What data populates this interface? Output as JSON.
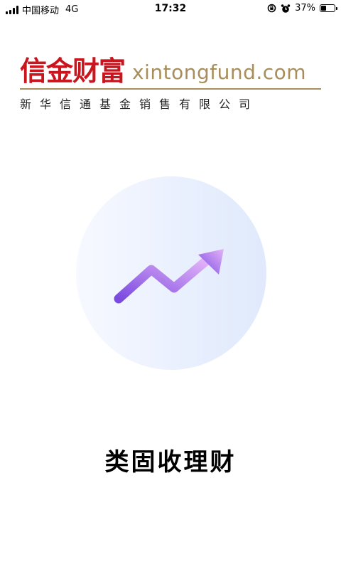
{
  "status_bar": {
    "carrier": "中国移动",
    "network": "4G",
    "time": "17:32",
    "battery_text": "37%",
    "battery_level": 0.37
  },
  "logo": {
    "brand_cn": "信金财富",
    "domain": "xintongfund.com",
    "company_name": "新华信通基金销售有限公司",
    "brand_color": "#c8151e",
    "accent_color": "#a88e5a"
  },
  "illustration": {
    "icon": "trend-up-arrow-icon",
    "gradient_start": "#7b4ae0",
    "gradient_end": "#e4b4f8"
  },
  "tagline": "类固收理财"
}
